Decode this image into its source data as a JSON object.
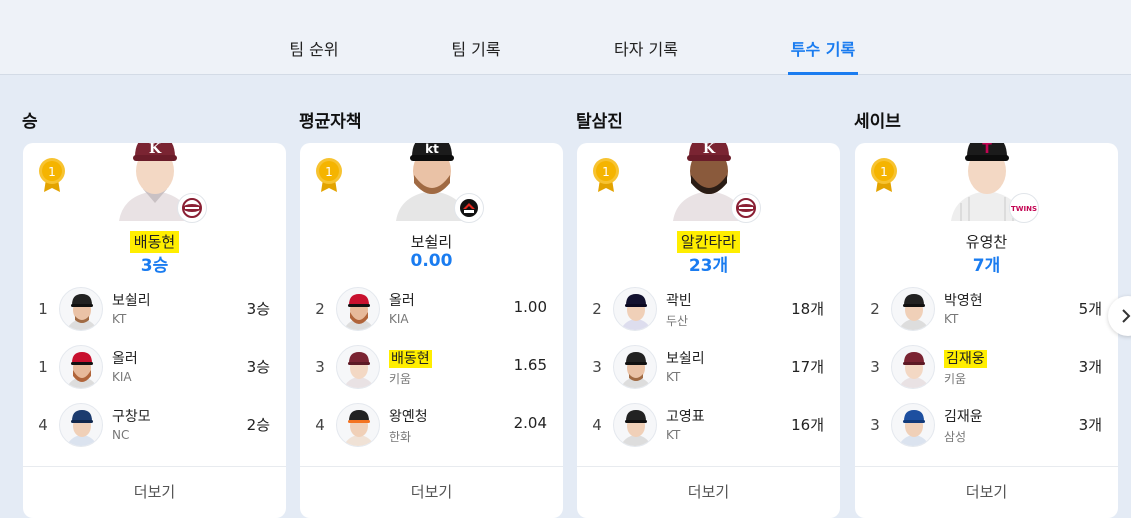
{
  "tabs": [
    {
      "label": "팀 순위"
    },
    {
      "label": "팀 기록"
    },
    {
      "label": "타자 기록"
    },
    {
      "label": "투수 기록"
    }
  ],
  "active_tab": "투수 기록",
  "accent_color": "#1a7cf0",
  "highlight_color": "#ffee00",
  "sections": [
    {
      "title": "승",
      "leader": {
        "rank": "1",
        "name": "배동현",
        "value": "3승",
        "team_logo": "kiwoom-logo",
        "highlighted": true
      },
      "rows": [
        {
          "rank": "1",
          "name": "보쉴리",
          "team": "KT",
          "value": "3승",
          "highlighted": false
        },
        {
          "rank": "1",
          "name": "올러",
          "team": "KIA",
          "value": "3승",
          "highlighted": false
        },
        {
          "rank": "4",
          "name": "구창모",
          "team": "NC",
          "value": "2승",
          "highlighted": false
        }
      ],
      "more_label": "더보기"
    },
    {
      "title": "평균자책",
      "leader": {
        "rank": "1",
        "name": "보쉴리",
        "value": "0.00",
        "team_logo": "kt-logo",
        "highlighted": false
      },
      "rows": [
        {
          "rank": "2",
          "name": "올러",
          "team": "KIA",
          "value": "1.00",
          "highlighted": false
        },
        {
          "rank": "3",
          "name": "배동현",
          "team": "키움",
          "value": "1.65",
          "highlighted": true
        },
        {
          "rank": "4",
          "name": "왕옌청",
          "team": "한화",
          "value": "2.04",
          "highlighted": false
        }
      ],
      "more_label": "더보기"
    },
    {
      "title": "탈삼진",
      "leader": {
        "rank": "1",
        "name": "알칸타라",
        "value": "23개",
        "team_logo": "kiwoom-logo",
        "highlighted": true
      },
      "rows": [
        {
          "rank": "2",
          "name": "곽빈",
          "team": "두산",
          "value": "18개",
          "highlighted": false
        },
        {
          "rank": "3",
          "name": "보쉴리",
          "team": "KT",
          "value": "17개",
          "highlighted": false
        },
        {
          "rank": "4",
          "name": "고영표",
          "team": "KT",
          "value": "16개",
          "highlighted": false
        }
      ],
      "more_label": "더보기"
    },
    {
      "title": "세이브",
      "leader": {
        "rank": "1",
        "name": "유영찬",
        "value": "7개",
        "team_logo": "lg-twins-logo",
        "highlighted": false
      },
      "rows": [
        {
          "rank": "2",
          "name": "박영현",
          "team": "KT",
          "value": "5개",
          "highlighted": false
        },
        {
          "rank": "3",
          "name": "김재웅",
          "team": "키움",
          "value": "3개",
          "highlighted": true
        },
        {
          "rank": "3",
          "name": "김재윤",
          "team": "삼성",
          "value": "3개",
          "highlighted": false
        }
      ],
      "more_label": "더보기"
    }
  ],
  "team_logo_text": {
    "lg": "TWINS"
  }
}
